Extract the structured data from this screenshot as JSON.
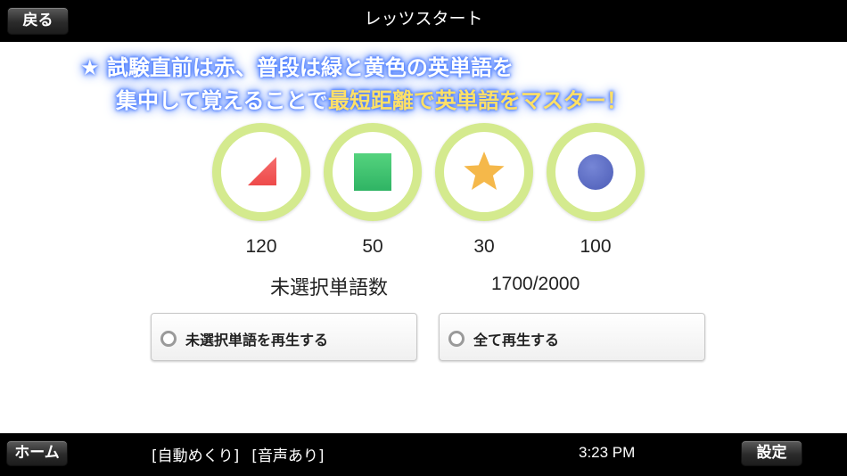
{
  "header": {
    "back_label": "戻る",
    "title": "レッツスタート"
  },
  "banner": {
    "star": "★",
    "line1": "試験直前は赤、普段は緑と黄色の英単語を",
    "line2_plain": "集中して覚えることで",
    "line2_highlight": "最短距離で英単語をマスター！"
  },
  "categories": [
    {
      "shape": "triangle-icon",
      "color": "#f25a5a",
      "count": "120"
    },
    {
      "shape": "square-icon",
      "color": "#3cc36e",
      "count": "50"
    },
    {
      "shape": "star-icon",
      "color": "#f5b84a",
      "count": "30"
    },
    {
      "shape": "circle-icon",
      "color": "#6577c9",
      "count": "100"
    }
  ],
  "unselected": {
    "label": "未選択単語数",
    "value": "1700/2000"
  },
  "options": {
    "play_unselected": "未選択単語を再生する",
    "play_all": "全て再生する"
  },
  "footer": {
    "home_label": "ホーム",
    "auto_flip": "[自動めくり]",
    "audio": "[音声あり]",
    "time": "3:23 PM",
    "settings_label": "設定"
  }
}
